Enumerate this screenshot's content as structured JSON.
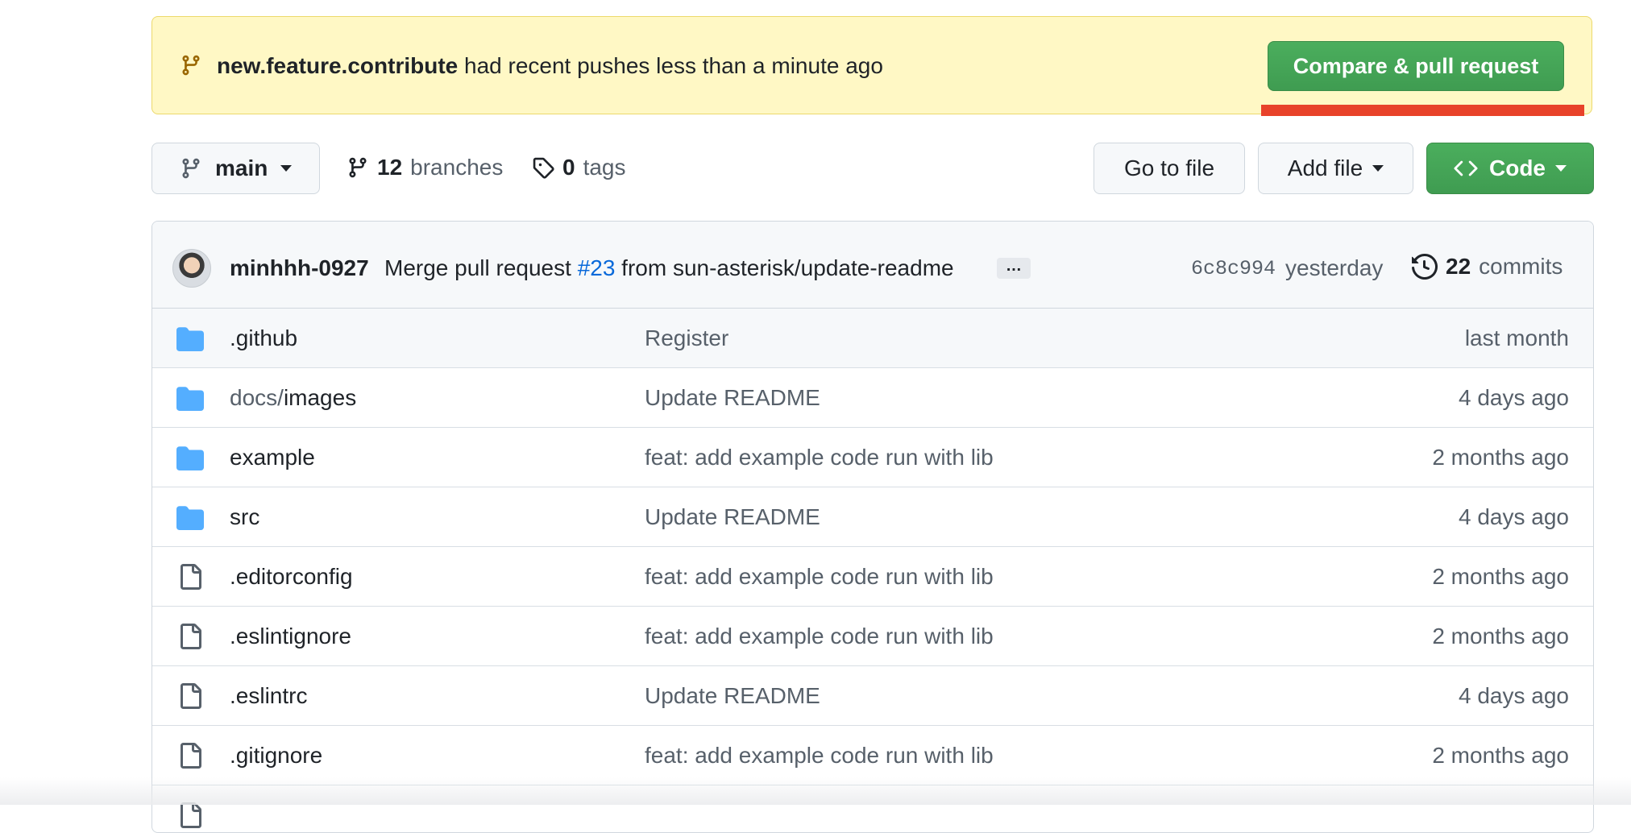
{
  "banner": {
    "branch": "new.feature.contribute",
    "message": " had recent pushes less than a minute ago",
    "button": "Compare & pull request"
  },
  "toolbar": {
    "branch_label": "main",
    "branches_count": "12",
    "branches_label": "branches",
    "tags_count": "0",
    "tags_label": "tags",
    "goto_file": "Go to file",
    "add_file": "Add file",
    "code": "Code"
  },
  "commit": {
    "author": "minhhh-0927",
    "message_prefix": "Merge pull request ",
    "pr_number": "#23",
    "message_suffix": " from sun-asterisk/update-readme",
    "ellipsis": "…",
    "sha": "6c8c994",
    "time": "yesterday",
    "commit_count": "22",
    "commit_label": "commits"
  },
  "files": [
    {
      "type": "folder",
      "prefix": "",
      "name": ".github",
      "message": "Register",
      "age": "last month"
    },
    {
      "type": "folder",
      "prefix": "docs/",
      "name": "images",
      "message": "Update README",
      "age": "4 days ago"
    },
    {
      "type": "folder",
      "prefix": "",
      "name": "example",
      "message": "feat: add example code run with lib",
      "age": "2 months ago"
    },
    {
      "type": "folder",
      "prefix": "",
      "name": "src",
      "message": "Update README",
      "age": "4 days ago"
    },
    {
      "type": "file",
      "prefix": "",
      "name": ".editorconfig",
      "message": "feat: add example code run with lib",
      "age": "2 months ago"
    },
    {
      "type": "file",
      "prefix": "",
      "name": ".eslintignore",
      "message": "feat: add example code run with lib",
      "age": "2 months ago"
    },
    {
      "type": "file",
      "prefix": "",
      "name": ".eslintrc",
      "message": "Update README",
      "age": "4 days ago"
    },
    {
      "type": "file",
      "prefix": "",
      "name": ".gitignore",
      "message": "feat: add example code run with lib",
      "age": "2 months ago"
    }
  ],
  "icons": {
    "banner": "git-branch-icon",
    "branch": "git-branch-icon",
    "tags": "tag-icon",
    "code": "code-icon",
    "commits": "history-icon",
    "folder": "folder-icon",
    "file": "file-icon"
  },
  "colors": {
    "banner_bg": "#fff8c5",
    "primary_green": "#3f9c51",
    "link_blue": "#0969da",
    "folder_blue": "#54aeff",
    "highlight_red": "#e8422a"
  }
}
